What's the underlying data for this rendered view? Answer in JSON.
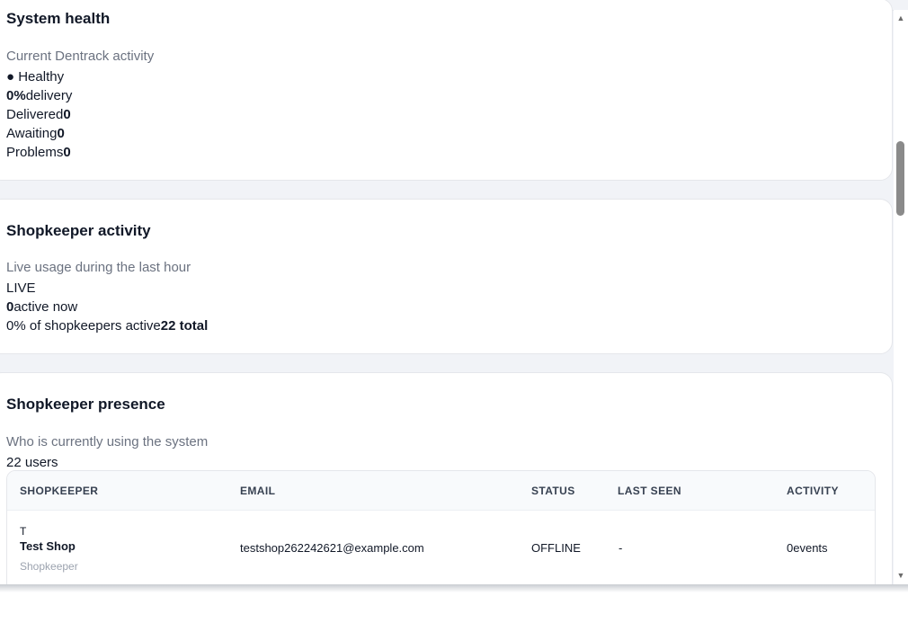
{
  "system_health": {
    "title": "System health",
    "subtitle": "Current Dentrack activity",
    "status": "● Healthy",
    "delivery_value": "0%",
    "delivery_label": "delivery",
    "delivered_label": "Delivered",
    "delivered_value": "0",
    "awaiting_label": "Awaiting",
    "awaiting_value": "0",
    "problems_label": "Problems",
    "problems_value": "0"
  },
  "shopkeeper_activity": {
    "title": "Shopkeeper activity",
    "subtitle": "Live usage during the last hour",
    "live_badge": "LIVE",
    "active_value": "0",
    "active_label": "active now",
    "percent_label": "0% of shopkeepers active",
    "total_label": "22 total"
  },
  "shopkeeper_presence": {
    "title": "Shopkeeper presence",
    "subtitle": "Who is currently using the system",
    "user_count": "22 users",
    "columns": [
      "SHOPKEEPER",
      "EMAIL",
      "STATUS",
      "LAST SEEN",
      "ACTIVITY"
    ],
    "rows": [
      {
        "avatar": "T",
        "name": "Test Shop",
        "role": "Shopkeeper",
        "email": "testshop262242621@example.com",
        "status": "OFFLINE",
        "last_seen": "-",
        "activity_value": "0",
        "activity_label": "events"
      }
    ]
  },
  "scrollbar": {
    "up_icon": "▲",
    "down_icon": "▼"
  }
}
